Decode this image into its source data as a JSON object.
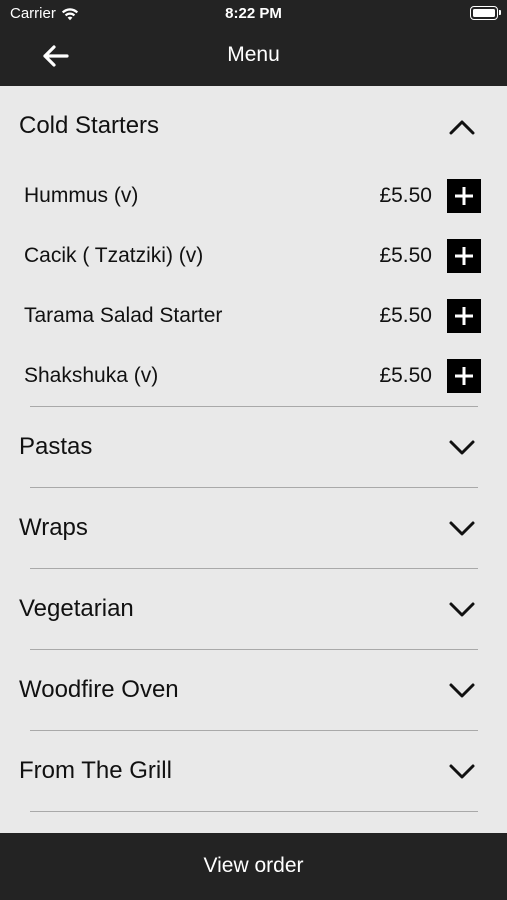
{
  "status_bar": {
    "carrier": "Carrier",
    "time": "8:22 PM",
    "wifi_icon": "wifi-icon",
    "battery_icon": "battery-icon"
  },
  "nav": {
    "title": "Menu",
    "back_icon": "arrow-left-icon"
  },
  "sections": [
    {
      "label": "Cold Starters",
      "expanded": true,
      "items": [
        {
          "name": "Hummus (v)",
          "price": "£5.50"
        },
        {
          "name": "Cacik ( Tzatziki) (v)",
          "price": "£5.50"
        },
        {
          "name": "Tarama Salad Starter",
          "price": "£5.50"
        },
        {
          "name": "Shakshuka (v)",
          "price": "£5.50"
        }
      ]
    },
    {
      "label": "Pastas",
      "expanded": false
    },
    {
      "label": "Wraps",
      "expanded": false
    },
    {
      "label": "Vegetarian",
      "expanded": false
    },
    {
      "label": "Woodfire Oven",
      "expanded": false
    },
    {
      "label": "From The Grill",
      "expanded": false
    }
  ],
  "footer": {
    "label": "View order"
  },
  "colors": {
    "bar_background": "#232323",
    "content_background": "#e9e9e9",
    "add_button": "#000000",
    "divider": "#a9a9a9"
  }
}
